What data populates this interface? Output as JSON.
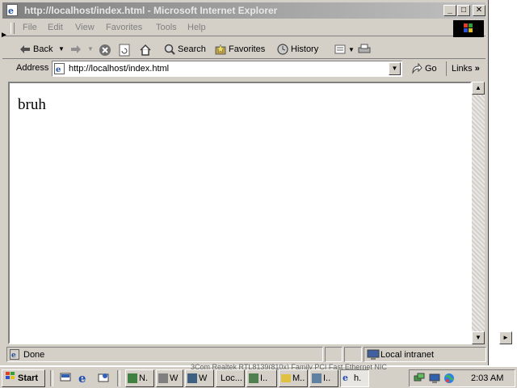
{
  "window": {
    "title": "http://localhost/index.html - Microsoft Internet Explorer"
  },
  "menu": {
    "items": [
      "File",
      "Edit",
      "View",
      "Favorites",
      "Tools",
      "Help"
    ]
  },
  "toolbar": {
    "back_label": "Back",
    "search_label": "Search",
    "favorites_label": "Favorites",
    "history_label": "History"
  },
  "address_bar": {
    "label": "Address",
    "url": "http://localhost/index.html",
    "go_label": "Go",
    "links_label": "Links"
  },
  "page": {
    "body_text": "bruh"
  },
  "status_bar": {
    "status_text": "Done",
    "zone_text": "Local intranet"
  },
  "taskbar": {
    "start_label": "Start",
    "tasks": [
      "N.",
      "W",
      "W",
      "Loc...",
      "I..",
      "M..",
      "I..",
      "h."
    ],
    "background_text": "3Com Realtek RTL8139(810x) Family PCI Fast Ethernet NIC",
    "clock": "2:03 AM"
  }
}
